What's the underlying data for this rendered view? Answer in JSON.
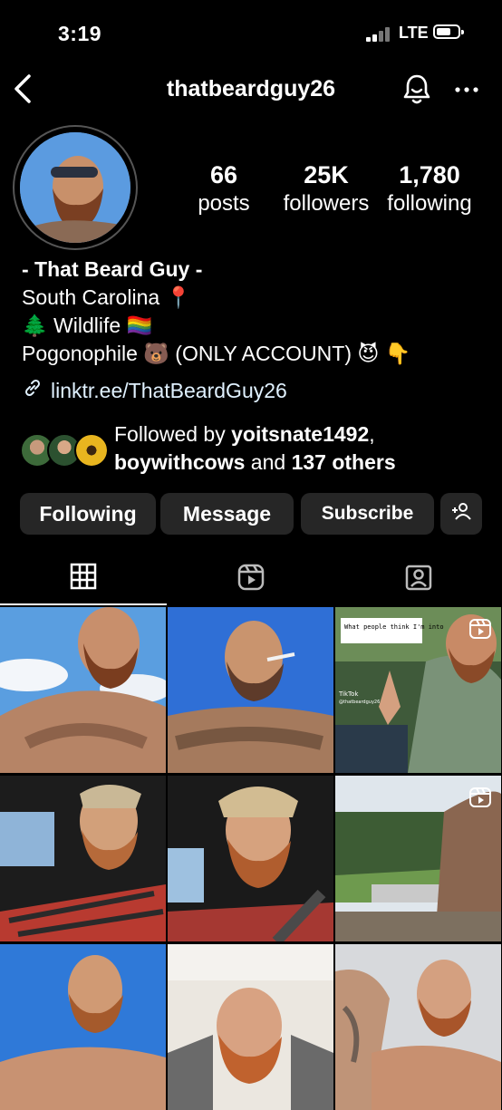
{
  "status_bar": {
    "time": "3:19",
    "network": "LTE"
  },
  "header": {
    "username": "thatbeardguy26"
  },
  "stats": [
    {
      "value": "66",
      "label": "posts"
    },
    {
      "value": "25K",
      "label": "followers"
    },
    {
      "value": "1,780",
      "label": "following"
    }
  ],
  "bio": {
    "name": "- That Beard Guy -",
    "line1": "South Carolina 📍",
    "line2": "🌲 Wildlife 🏳️‍🌈",
    "line3": "Pogonophile 🐻 (ONLY ACCOUNT) 😈 👇",
    "link": "linktr.ee/ThatBeardGuy26"
  },
  "followed_by": {
    "prefix": "Followed by ",
    "user1": "yoitsnate1492",
    "comma": ",",
    "user2": "boywithcows",
    "mid": " and ",
    "others": "137 others"
  },
  "actions": {
    "following": "Following",
    "message": "Message",
    "subscribe": "Subscribe"
  },
  "posts": [
    {
      "caption": ""
    },
    {
      "caption": ""
    },
    {
      "caption": "What people think I'm into"
    },
    {
      "caption": ""
    },
    {
      "caption": ""
    },
    {
      "caption": ""
    },
    {
      "caption": ""
    },
    {
      "caption": ""
    },
    {
      "caption": ""
    }
  ],
  "tiktok": {
    "label": "TikTok",
    "handle": "@thatbeardguy26"
  }
}
